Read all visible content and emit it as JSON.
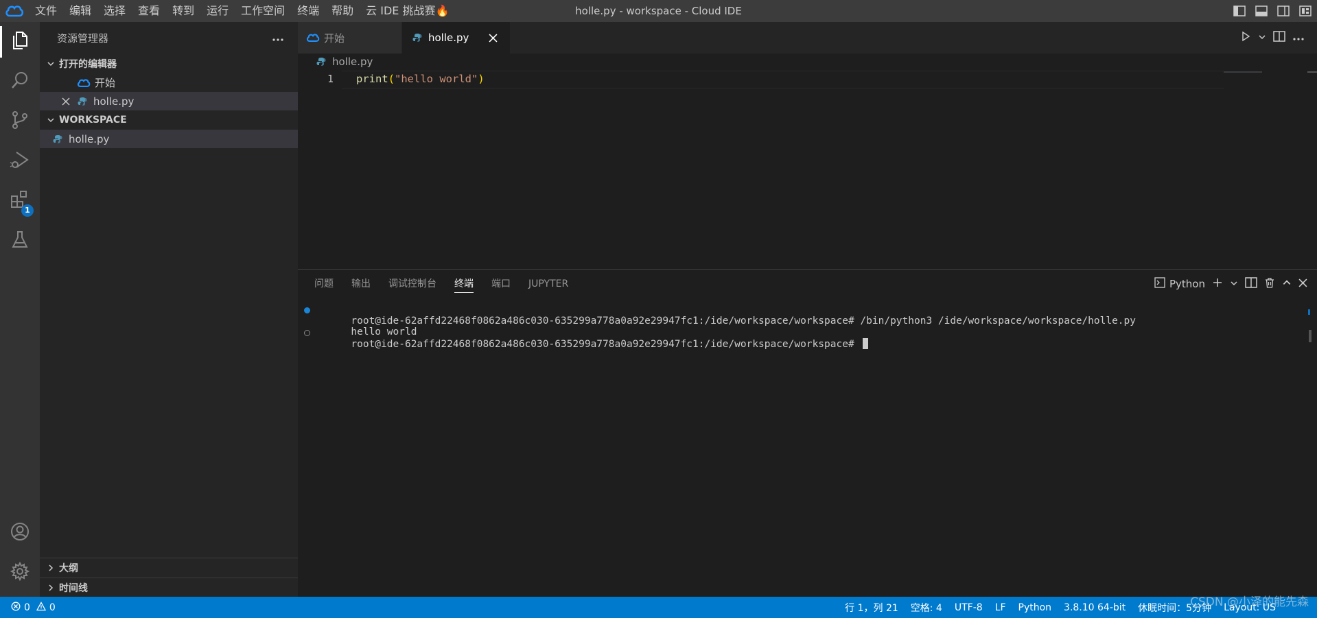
{
  "window": {
    "title": "holle.py - workspace - Cloud IDE"
  },
  "menu": [
    "文件",
    "编辑",
    "选择",
    "查看",
    "转到",
    "运行",
    "工作空间",
    "终端",
    "帮助",
    "云 IDE 挑战赛🔥"
  ],
  "activity_bar": {
    "items": [
      {
        "name": "explorer",
        "icon": "files-icon",
        "active": true
      },
      {
        "name": "search",
        "icon": "search-icon"
      },
      {
        "name": "source-control",
        "icon": "source-control-icon"
      },
      {
        "name": "run-debug",
        "icon": "run-debug-icon"
      },
      {
        "name": "extensions",
        "icon": "extensions-icon",
        "badge": "1"
      },
      {
        "name": "testing",
        "icon": "beaker-icon"
      }
    ],
    "bottom": [
      {
        "name": "accounts",
        "icon": "account-icon"
      },
      {
        "name": "manage",
        "icon": "gear-icon"
      }
    ]
  },
  "sidebar": {
    "title": "资源管理器",
    "open_editors": {
      "label": "打开的编辑器",
      "items": [
        {
          "label": "开始"
        },
        {
          "label": "holle.py"
        }
      ]
    },
    "workspace": {
      "label": "WORKSPACE",
      "items": [
        {
          "label": "holle.py"
        }
      ]
    },
    "outline_label": "大纲",
    "timeline_label": "时间线"
  },
  "editor": {
    "tabs": [
      {
        "label": "开始",
        "active": false
      },
      {
        "label": "holle.py",
        "active": true
      }
    ],
    "breadcrumb": "holle.py",
    "lines": [
      {
        "number": "1",
        "fn": "print",
        "open": "(",
        "str": "\"hello world\"",
        "close": ")"
      }
    ]
  },
  "panel": {
    "tabs": [
      "问题",
      "输出",
      "调试控制台",
      "终端",
      "端口",
      "JUPYTER"
    ],
    "active_tab": "终端",
    "terminal_profile": "Python",
    "terminal_lines": [
      {
        "text": "root@ide-62affd22468f0862a486c030-635299a778a0a92e29947fc1:/ide/workspace/workspace# /bin/python3 /ide/workspace/workspace/holle.py",
        "deco": "ok"
      },
      {
        "text": "hello world",
        "deco": ""
      },
      {
        "text": "root@ide-62affd22468f0862a486c030-635299a778a0a92e29947fc1:/ide/workspace/workspace# ",
        "deco": "empty",
        "cursor": true
      }
    ]
  },
  "statusbar": {
    "errors": "0",
    "warnings": "0",
    "position": "行 1，列 21",
    "spaces": "空格: 4",
    "encoding": "UTF-8",
    "eol": "LF",
    "language": "Python",
    "interpreter": "3.8.10 64-bit",
    "idle": "休眠时间：5分钟",
    "layout": "Layout: US"
  },
  "watermark": "CSDN @小泽的能先森",
  "colors": {
    "accent": "#007acc",
    "logo": "#1e90ff",
    "python_icon": "#519aba"
  }
}
